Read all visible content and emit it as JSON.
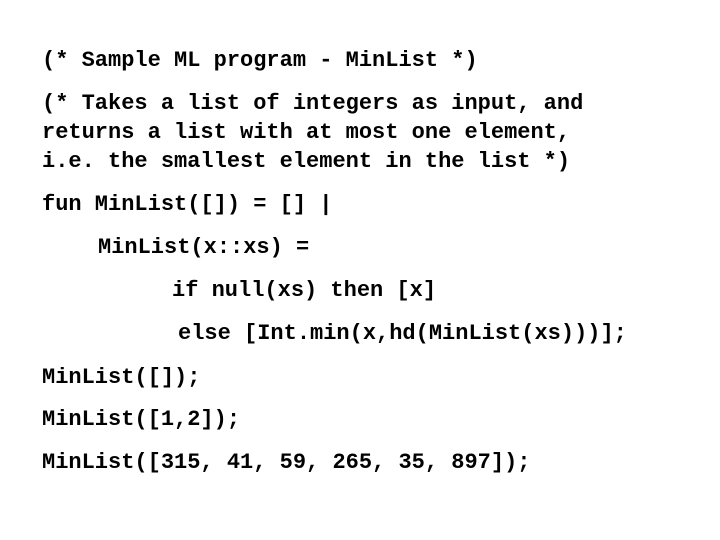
{
  "slide": {
    "background_color": "#ffffff",
    "text_color": "#000000",
    "language": "Standard ML",
    "title_comment": "(* Sample ML program - MinList *)",
    "description_comment": {
      "line1": "(* Takes a list of integers as input, and",
      "line2": "returns a list with at most one element,",
      "line3": "i.e. the smallest element in the list *)"
    },
    "function_definition": {
      "clause1": "fun MinList([]) = [] |",
      "clause2": "MinList(x::xs) =",
      "then_branch": "if null(xs) then [x]",
      "else_branch": "else [Int.min(x,hd(MinList(xs)))];"
    },
    "invocations": {
      "call1": "MinList([]);",
      "call2": "MinList([1,2]);",
      "call3": "MinList([315, 41, 59, 265, 35, 897]);"
    }
  }
}
